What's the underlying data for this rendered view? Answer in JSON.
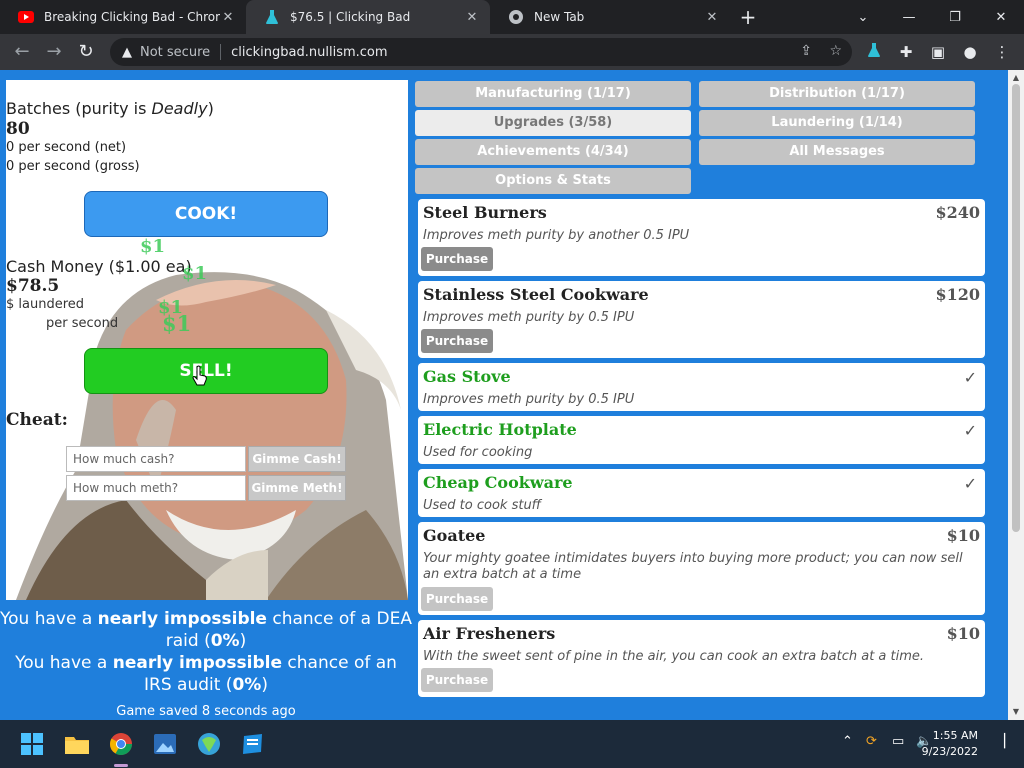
{
  "browser": {
    "tabs": [
      {
        "title": "Breaking Clicking Bad - Chrome W",
        "favicon": "youtube-icon",
        "active": false
      },
      {
        "title": "$76.5 | Clicking Bad",
        "favicon": "flask-icon",
        "active": true
      },
      {
        "title": "New Tab",
        "favicon": "chrome-icon",
        "active": false
      }
    ],
    "security_label": "Not secure",
    "url": "clickingbad.nullism.com"
  },
  "game": {
    "batches_prefix": "Batches (purity is ",
    "purity": "Deadly",
    "batches_suffix": ")",
    "batches_count": "80",
    "rate_net": "0 per second (net)",
    "rate_gross": "0 per second (gross)",
    "cook_label": "COOK!",
    "cash_title": "Cash Money ($1.00 ea)",
    "cash_amount": "$78.5",
    "laundered": "$ laundered",
    "per_second": "per second",
    "floating_dollars": [
      "$1",
      "$1",
      "$1",
      "$1"
    ],
    "sell_label": "SELL!",
    "cheat_title": "Cheat:",
    "cash_placeholder": "How much cash?",
    "cash_button": "Gimme Cash!",
    "meth_placeholder": "How much meth?",
    "meth_button": "Gimme Meth!",
    "dea": {
      "prefix": "You have a ",
      "level": "nearly impossible",
      "middle": " chance of a DEA raid (",
      "pct": "0%",
      "suffix": ")"
    },
    "irs": {
      "prefix": "You have a ",
      "level": "nearly impossible",
      "middle": " chance of an IRS audit (",
      "pct": "0%",
      "suffix": ")"
    },
    "saved": "Game saved 8 seconds ago"
  },
  "menu": {
    "manufacturing": "Manufacturing (1/17)",
    "distribution": "Distribution (1/17)",
    "upgrades": "Upgrades (3/58)",
    "laundering": "Laundering (1/14)",
    "achievements": "Achievements (4/34)",
    "all_messages": "All Messages",
    "options": "Options & Stats"
  },
  "upgrades": [
    {
      "name": "Steel Burners",
      "price": "$240",
      "desc": "Improves meth purity by another 0.5 IPU",
      "action": "Purchase"
    },
    {
      "name": "Stainless Steel Cookware",
      "price": "$120",
      "desc": "Improves meth purity by 0.5 IPU",
      "action": "Purchase"
    },
    {
      "name": "Gas Stove",
      "desc": "Improves meth purity by 0.5 IPU",
      "owned": "✓"
    },
    {
      "name": "Electric Hotplate",
      "desc": "Used for cooking",
      "owned": "✓"
    },
    {
      "name": "Cheap Cookware",
      "desc": "Used to cook stuff",
      "owned": "✓"
    },
    {
      "name": "Goatee",
      "price": "$10",
      "desc": "Your mighty goatee intimidates buyers into buying more product; you can now sell an extra batch at a time",
      "action": "Purchase"
    },
    {
      "name": "Air Fresheners",
      "price": "$10",
      "desc": "With the sweet sent of pine in the air, you can cook an extra batch at a time.",
      "action": "Purchase"
    }
  ],
  "taskbar": {
    "time": "1:55 AM",
    "date": "9/23/2022"
  },
  "colors": {
    "page_bg": "#1f7fdc",
    "cook_button": "#3c9af0",
    "sell_button": "#22cc22",
    "owned_text": "#1e9e1e"
  }
}
